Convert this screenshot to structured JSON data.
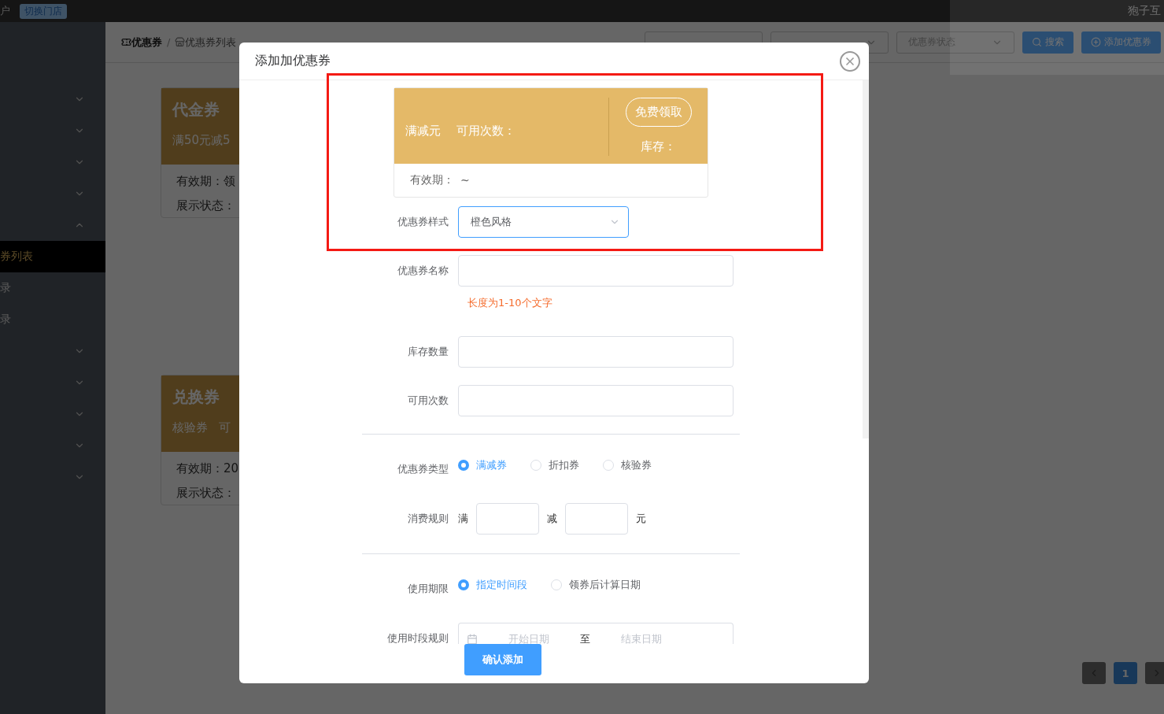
{
  "topbar": {
    "user_text": "户",
    "switch_store_button": "切换门店",
    "brand": "狍子互"
  },
  "sidebar": {
    "items": [
      {
        "kind": "group",
        "expanded": false
      },
      {
        "kind": "group",
        "expanded": false
      },
      {
        "kind": "group",
        "expanded": false
      },
      {
        "kind": "group",
        "expanded": false
      },
      {
        "kind": "group",
        "expanded": true
      },
      {
        "kind": "link",
        "label": "券列表",
        "selected": true
      },
      {
        "kind": "link",
        "label": "录",
        "selected": false
      },
      {
        "kind": "link",
        "label": "录",
        "selected": false
      },
      {
        "kind": "group",
        "expanded": false
      },
      {
        "kind": "group",
        "expanded": false
      },
      {
        "kind": "group",
        "expanded": false
      },
      {
        "kind": "group",
        "expanded": false
      },
      {
        "kind": "group",
        "expanded": false
      }
    ]
  },
  "breadcrumb": [
    "优惠券",
    "优惠券列表"
  ],
  "breadcrumb_separator": "/",
  "filters": [
    {
      "kind": "input"
    },
    {
      "kind": "select"
    },
    {
      "kind": "select",
      "placeholder": "优惠券状态"
    }
  ],
  "search_button": "搜索",
  "add_button": "添加优惠券",
  "cards": [
    {
      "title": "代金券",
      "subtitle": [
        "满50元减5"
      ],
      "validity": "有效期：领",
      "display_status": "展示状态："
    },
    {
      "title": "兑换券",
      "subtitle": [
        "核验券",
        "可"
      ],
      "validity": "有效期：20",
      "display_status": "展示状态："
    }
  ],
  "pagination": {
    "pages": [
      {
        "label": "1",
        "selected": true
      }
    ]
  },
  "modal": {
    "title": "添加加优惠券",
    "preview": {
      "discount": "满减元",
      "uses": "可用次数：",
      "claim_button": "免费领取",
      "stock": "库存：",
      "validity_label": "有效期：",
      "validity_value": "~"
    },
    "form": [
      {
        "kind": "select",
        "label": "优惠券样式",
        "value": "橙色风格"
      },
      {
        "kind": "input",
        "label": "优惠券名称",
        "hint": "长度为1-10个文字"
      },
      {
        "kind": "input",
        "label": "库存数量"
      },
      {
        "kind": "input",
        "label": "可用次数"
      },
      {
        "kind": "divider"
      },
      {
        "kind": "radio",
        "label": "优惠券类型",
        "options": [
          {
            "label": "满减券",
            "selected": true
          },
          {
            "label": "折扣券",
            "selected": false
          },
          {
            "label": "核验券",
            "selected": false
          }
        ]
      },
      {
        "kind": "rule",
        "label": "消费规则",
        "parts": [
          "满",
          "减",
          "元"
        ]
      },
      {
        "kind": "divider"
      },
      {
        "kind": "radio",
        "label": "使用期限",
        "options": [
          {
            "label": "指定时间段",
            "selected": true
          },
          {
            "label": "领券后计算日期",
            "selected": false
          }
        ]
      },
      {
        "kind": "date_range",
        "label": "使用时段规则",
        "start_placeholder": "开始日期",
        "separator": "至",
        "end_placeholder": "结束日期"
      }
    ],
    "submit_button": "确认添加"
  }
}
